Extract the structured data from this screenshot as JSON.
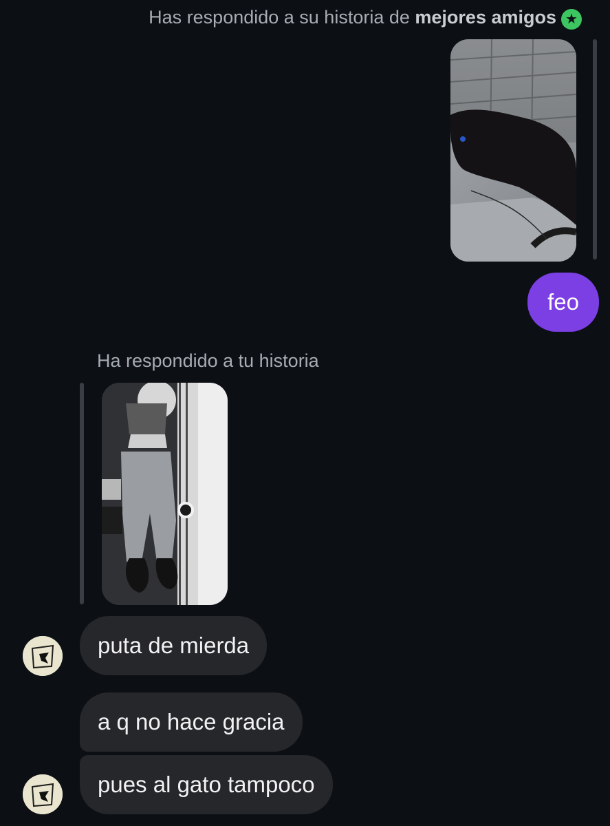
{
  "conversation": {
    "outgoing_reply_caption_prefix": "Has respondido a su historia de",
    "outgoing_reply_caption_bold": "mejores amigos",
    "incoming_reply_caption": "Ha respondido a tu historia",
    "messages": [
      {
        "from": "me",
        "text": "feo"
      },
      {
        "from": "them",
        "text": "puta de mierda"
      },
      {
        "from": "them",
        "text": "a q no hace gracia"
      },
      {
        "from": "them",
        "text": "pues al gato tampoco"
      }
    ]
  },
  "icons": {
    "close_friends_badge": "star-icon",
    "badge_color": "#3cc561"
  },
  "colors": {
    "background": "#0c0f14",
    "outgoing_bubble": "#7b3fe4",
    "incoming_bubble": "#25272b"
  }
}
